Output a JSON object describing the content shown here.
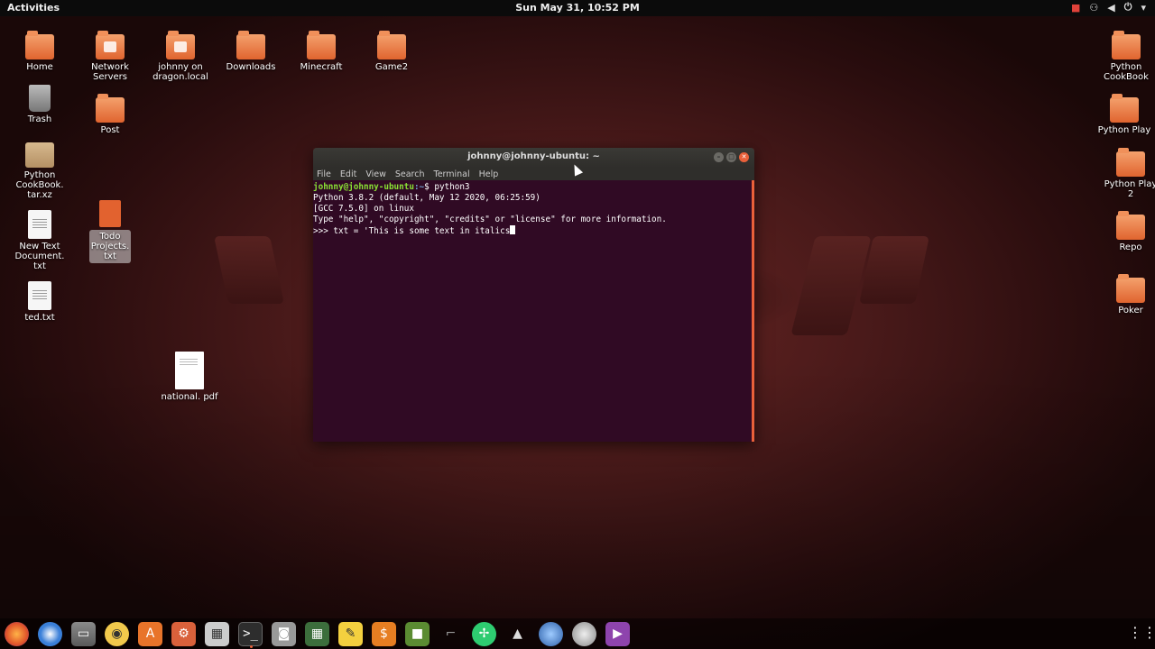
{
  "topbar": {
    "activities": "Activities",
    "clock": "Sun May 31, 10:52 PM",
    "tray_icons": [
      "record-icon",
      "network-icon",
      "volume-icon",
      "power-icon"
    ]
  },
  "desktop_left": [
    {
      "label": "Home",
      "icon": "home-folder-icon"
    },
    {
      "label": "Network Servers",
      "icon": "network-folder-icon"
    },
    {
      "label": "johnny on dragon.local",
      "icon": "network-share-icon"
    },
    {
      "label": "Downloads",
      "icon": "downloads-folder-icon"
    },
    {
      "label": "Minecraft",
      "icon": "folder-icon"
    },
    {
      "label": "Game2",
      "icon": "folder-icon"
    },
    {
      "label": "Trash",
      "icon": "trash-icon"
    },
    {
      "label": "Post",
      "icon": "folder-icon"
    },
    {
      "label": "Python CookBook. tar.xz",
      "icon": "archive-icon"
    },
    {
      "label": "New Text Document. txt",
      "icon": "text-file-icon"
    },
    {
      "label": "Todo Projects. txt",
      "icon": "text-file-icon"
    },
    {
      "label": "ted.txt",
      "icon": "text-file-icon"
    },
    {
      "label": "national. pdf",
      "icon": "pdf-icon"
    }
  ],
  "desktop_right": [
    {
      "label": "Python CookBook"
    },
    {
      "label": "Python Play"
    },
    {
      "label": "Python Play 2"
    },
    {
      "label": "Repo"
    },
    {
      "label": "Poker"
    }
  ],
  "terminal": {
    "title": "johnny@johnny-ubuntu: ~",
    "menu": [
      "File",
      "Edit",
      "View",
      "Search",
      "Terminal",
      "Help"
    ],
    "prompt_user": "johnny@johnny-ubuntu",
    "prompt_path": ":~",
    "prompt_suffix": "$ python3",
    "line1": "Python 3.8.2 (default, May 12 2020, 06:25:59)",
    "line2": "[GCC 7.5.0] on linux",
    "line3": "Type \"help\", \"copyright\", \"credits\" or \"license\" for more information.",
    "line4": ">>> txt = 'This is some text in italics"
  },
  "dock": {
    "apps": [
      "firefox-icon",
      "thunderbird-icon",
      "files-icon",
      "rhythmbox-icon",
      "software-icon",
      "settings-icon",
      "terminal-icon-alt",
      "terminal-icon",
      "screenshot-icon",
      "calculator-icon",
      "sticky-notes-icon",
      "money-icon",
      "minecraft-icon",
      "gun-icon",
      "green-app-icon",
      "inkscape-icon",
      "globe-icon",
      "snail-icon",
      "media-icon"
    ],
    "show_apps": "show-applications-icon"
  }
}
